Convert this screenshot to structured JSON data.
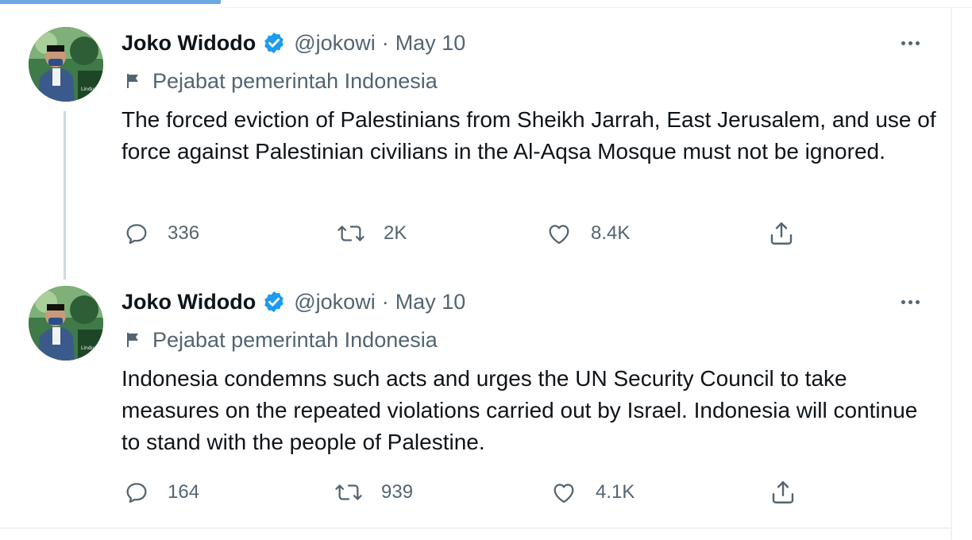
{
  "tweets": [
    {
      "name": "Joko Widodo",
      "handle": "@jokowi",
      "separator": "·",
      "date": "May 10",
      "label": "Pejabat pemerintah Indonesia",
      "text": "The forced eviction of Palestinians from Sheikh Jarrah, East Jerusalem, and use of force against Palestinian civilians in the Al-Aqsa Mosque must not be ignored.",
      "replies": "336",
      "retweets": "2K",
      "likes": "8.4K"
    },
    {
      "name": "Joko Widodo",
      "handle": "@jokowi",
      "separator": "·",
      "date": "May 10",
      "label": "Pejabat pemerintah Indonesia",
      "text": "Indonesia condemns such acts and urges the UN Security Council to take measures on the repeated violations carried out by Israel. Indonesia will continue to stand with the people of Palestine.",
      "replies": "164",
      "retweets": "939",
      "likes": "4.1K"
    }
  ],
  "colors": {
    "text": "#0f1419",
    "secondary": "#536471",
    "verified": "#1d9bf0",
    "divider": "#eff3f4",
    "thread_line": "#cfd9de"
  },
  "icons": [
    "verified-badge-icon",
    "flag-icon",
    "more-icon",
    "reply-icon",
    "retweet-icon",
    "like-icon",
    "share-icon"
  ]
}
